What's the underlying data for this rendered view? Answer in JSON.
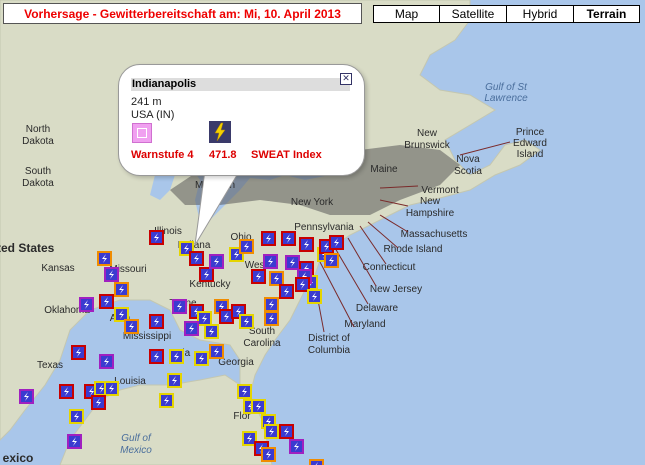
{
  "header": {
    "title": "Vorhersage - Gewitterbereitschaft am: Mi, 10. April 2013"
  },
  "map_types": [
    {
      "label": "Map",
      "active": false
    },
    {
      "label": "Satellite",
      "active": false
    },
    {
      "label": "Hybrid",
      "active": false
    },
    {
      "label": "Terrain",
      "active": true
    }
  ],
  "popup": {
    "city": "Indianapolis",
    "elevation": "241 m",
    "country": "USA (IN)",
    "warning_label": "Warnstufe 4",
    "sweat_value": "471.8",
    "sweat_label": "SWEAT Index",
    "warning_icon": "warning-level-icon",
    "bolt_icon": "lightning-icon",
    "close_icon": "close-icon"
  },
  "colors": {
    "title_text": "#ee0000",
    "warn_label": "#dd0000",
    "water": "#a9c6ea",
    "land": "#d8d9c7",
    "marker_yellow": "#e5d400",
    "marker_orange": "#f08c00",
    "marker_red": "#c80000",
    "marker_purple": "#a020c0",
    "marker_inner": "#3b3bd0"
  },
  "map_labels": {
    "north_dakota": "North\nDakota",
    "south_dakota": "South\nDakota",
    "united_states": "ited States",
    "kansas": "Kansas",
    "missouri": "Missouri",
    "oklahoma": "Oklahoma",
    "texas": "Texas",
    "illinois": "Illinois",
    "indiana": "Indiana",
    "ohio": "Ohio",
    "kentucky": "Kentucky",
    "tennessee": "Tenne",
    "mississippi": "Mississippi",
    "arkansas": "Arka",
    "alabama": "Ala",
    "louisiana": "Louisia",
    "georgia": "Georgia",
    "south_carolina": "South\nCarolina",
    "michigan": "Michigan",
    "new_york": "New York",
    "pennsylvania": "Pennsylvania",
    "maine": "Maine",
    "vermont": "Vermont",
    "new_hampshire": "New\nHampshire",
    "massachusetts": "Massachusetts",
    "rhode_island": "Rhode Island",
    "connecticut": "Connecticut",
    "new_jersey": "New Jersey",
    "delaware": "Delaware",
    "maryland": "Maryland",
    "dc": "District of\nColumbia",
    "west": "West",
    "new_brunswick": "New\nBrunswick",
    "nova_scotia": "Nova\nScotia",
    "pei": "Prince\nEdward\nIsland",
    "gulf_st_lawrence": "Gulf of St\nLawrence",
    "gulf_mexico": "Gulf of\nMexico",
    "mexico": "exico",
    "florida": "Flor"
  },
  "markers": [
    {
      "color": "orange"
    },
    {
      "color": "red"
    },
    {
      "color": "purple"
    },
    {
      "color": "yellow"
    },
    {
      "color": "red"
    },
    {
      "color": "orange"
    },
    {
      "color": "red"
    },
    {
      "color": "purple"
    },
    {
      "color": "yellow"
    },
    {
      "color": "red"
    },
    {
      "color": "red"
    },
    {
      "color": "orange"
    },
    {
      "color": "purple"
    },
    {
      "color": "red"
    },
    {
      "color": "yellow"
    },
    {
      "color": "red"
    },
    {
      "color": "red"
    },
    {
      "color": "orange"
    },
    {
      "color": "purple"
    },
    {
      "color": "red"
    },
    {
      "color": "yellow"
    },
    {
      "color": "orange"
    },
    {
      "color": "red"
    },
    {
      "color": "purple"
    },
    {
      "color": "red"
    },
    {
      "color": "yellow"
    },
    {
      "color": "orange"
    },
    {
      "color": "red"
    },
    {
      "color": "purple"
    },
    {
      "color": "red"
    },
    {
      "color": "yellow"
    },
    {
      "color": "orange"
    },
    {
      "color": "red"
    },
    {
      "color": "red"
    },
    {
      "color": "purple"
    },
    {
      "color": "yellow"
    },
    {
      "color": "yellow"
    },
    {
      "color": "orange"
    },
    {
      "color": "red"
    },
    {
      "color": "purple"
    },
    {
      "color": "red"
    },
    {
      "color": "orange"
    },
    {
      "color": "yellow"
    },
    {
      "color": "red"
    },
    {
      "color": "purple"
    },
    {
      "color": "red"
    },
    {
      "color": "yellow"
    },
    {
      "color": "yellow"
    },
    {
      "color": "orange"
    },
    {
      "color": "purple"
    },
    {
      "color": "red"
    },
    {
      "color": "red"
    },
    {
      "color": "yellow"
    },
    {
      "color": "yellow"
    },
    {
      "color": "yellow"
    },
    {
      "color": "yellow"
    },
    {
      "color": "yellow"
    },
    {
      "color": "yellow"
    },
    {
      "color": "yellow"
    },
    {
      "color": "yellow"
    },
    {
      "color": "yellow"
    },
    {
      "color": "yellow"
    },
    {
      "color": "red"
    },
    {
      "color": "orange"
    },
    {
      "color": "red"
    },
    {
      "color": "purple"
    },
    {
      "color": "orange"
    },
    {
      "color": "red"
    },
    {
      "color": "yellow"
    },
    {
      "color": "purple"
    }
  ]
}
